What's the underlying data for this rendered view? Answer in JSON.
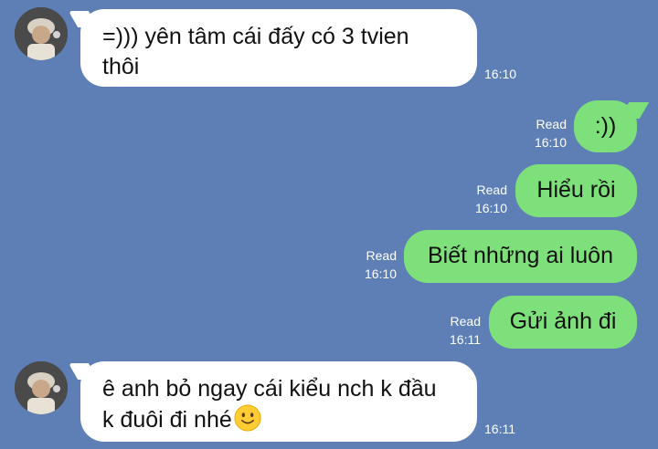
{
  "messages": [
    {
      "direction": "in",
      "lines": [
        "=))) yên tâm cái đấy có 3 tvien",
        "thôi"
      ],
      "time": "16:10"
    },
    {
      "direction": "out",
      "text": ":))",
      "status": "Read",
      "time": "16:10"
    },
    {
      "direction": "out",
      "text": "Hiểu rồi",
      "status": "Read",
      "time": "16:10"
    },
    {
      "direction": "out",
      "text": "Biết những ai luôn",
      "status": "Read",
      "time": "16:10"
    },
    {
      "direction": "out",
      "text": "Gửi ảnh đi",
      "status": "Read",
      "time": "16:11"
    },
    {
      "direction": "in",
      "lines": [
        "ê anh bỏ ngay cái kiểu nch k đầu",
        "k đuôi đi nhé"
      ],
      "emoji": "slightly-smiling-face-icon",
      "time": "16:11"
    }
  ],
  "colors": {
    "background": "#5d7fb5",
    "incoming_bubble": "#ffffff",
    "outgoing_bubble": "#7ee07a",
    "meta_text": "#ffffff"
  }
}
